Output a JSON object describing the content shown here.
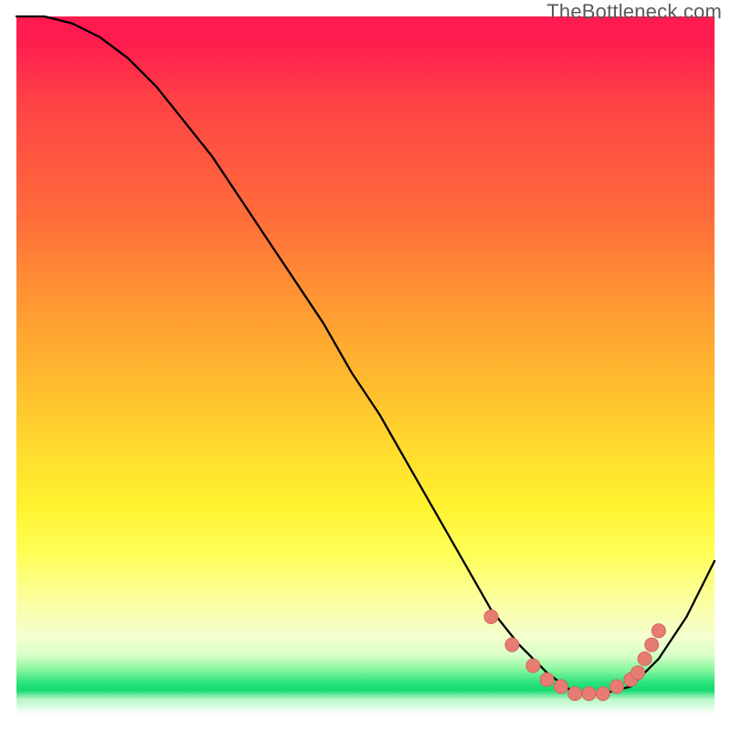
{
  "watermark": "TheBottleneck.com",
  "colors": {
    "curve": "#000000",
    "markers": "#e77c73",
    "marker_stroke": "#d4665d"
  },
  "chart_data": {
    "type": "line",
    "title": "",
    "xlabel": "",
    "ylabel": "",
    "xlim": [
      0,
      100
    ],
    "ylim": [
      0,
      100
    ],
    "grid": false,
    "legend": false,
    "series": [
      {
        "name": "curve",
        "x": [
          0,
          4,
          8,
          12,
          16,
          20,
          24,
          28,
          32,
          36,
          40,
          44,
          48,
          52,
          56,
          60,
          64,
          68,
          72,
          76,
          80,
          84,
          88,
          92,
          96,
          100
        ],
        "values": [
          100,
          100,
          99,
          97,
          94,
          90,
          85,
          80,
          74,
          68,
          62,
          56,
          49,
          43,
          36,
          29,
          22,
          15,
          10,
          6,
          3,
          3,
          4,
          8,
          14,
          22
        ]
      }
    ],
    "markers": {
      "name": "valley-dots",
      "x": [
        68,
        71,
        74,
        76,
        78,
        80,
        82,
        84,
        86,
        88,
        89,
        90,
        91,
        92
      ],
      "values": [
        14,
        10,
        7,
        5,
        4,
        3,
        3,
        3,
        4,
        5,
        6,
        8,
        10,
        12
      ]
    }
  }
}
